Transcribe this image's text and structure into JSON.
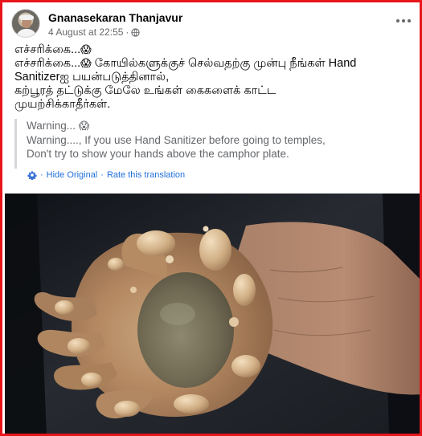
{
  "post": {
    "author": "Gnanasekaran Thanjavur",
    "timestamp": "4 August at 22:55",
    "separator": "·",
    "icons": {
      "audience": "globe-icon",
      "more": "more-options-icon",
      "translation": "gear-icon",
      "emoji": "face-screaming-in-fear-icon"
    },
    "body_lines": [
      "எச்சரிக்கை...",
      "எச்சரிக்கை...",
      " கோயில்களுக்குச் செல்வதற்கு முன்பு நீங்கள் Hand",
      "Sanitizerஐ பயன்படுத்தினால்,",
      "கற்பூரத் தட்டுக்கு மேலே உங்கள் கைகளைக் காட்ட",
      "முயற்சிக்காதீர்கள்."
    ],
    "translation_lines": [
      "Warning...",
      "Warning...., If you use Hand Sanitizer before going to temples,",
      "Don't try to show your hands above the camphor plate."
    ],
    "actions": {
      "hide_original": "Hide Original",
      "rate_translation": "Rate this translation",
      "dot": "·"
    }
  },
  "colors": {
    "border": "#e8151b",
    "link": "#216fdb",
    "muted": "#65676b",
    "text": "#050505"
  }
}
